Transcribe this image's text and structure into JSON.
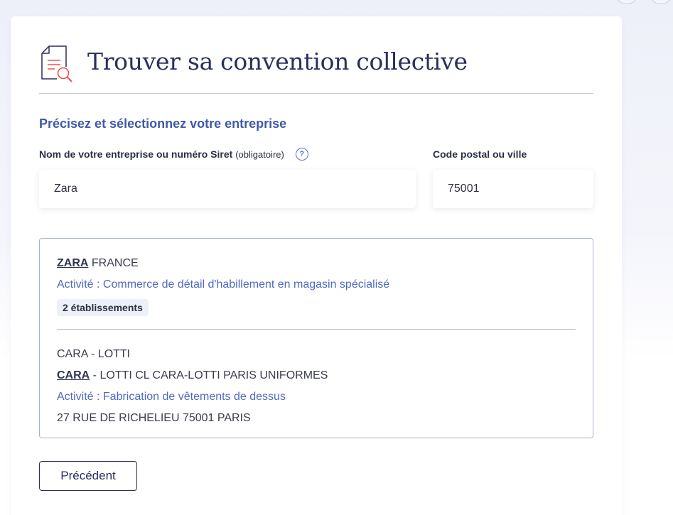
{
  "page": {
    "title": "Trouver sa convention collective"
  },
  "form": {
    "section_title": "Précisez et sélectionnez votre entreprise",
    "company_label": "Nom de votre entreprise ou numéro Siret",
    "company_label_optional": "(obligatoire)",
    "company_value": "Zara",
    "postal_label": "Code postal ou ville",
    "postal_value": "75001"
  },
  "results": [
    {
      "name_match": "ZARA",
      "name_rest": " FRANCE",
      "activity": "Activité : Commerce de détail d'habillement en magasin spécialisé",
      "badge": "2 établissements"
    },
    {
      "title": "CARA - LOTTI",
      "name_match": "CARA",
      "name_rest": " - LOTTI CL CARA-LOTTI PARIS UNIFORMES",
      "activity": "Activité : Fabrication de vêtements de dessus",
      "address": "27 RUE DE RICHELIEU 75001 PARIS"
    }
  ],
  "nav": {
    "previous_label": "Précédent"
  },
  "icons": {
    "header_icon": "document-search-icon",
    "help_icon": "question-circle-icon"
  },
  "colors": {
    "primary": "#2b2f5c",
    "accent_blue": "#3f58a8",
    "activity_blue": "#4f6ac0",
    "search_red": "#e8574f"
  }
}
